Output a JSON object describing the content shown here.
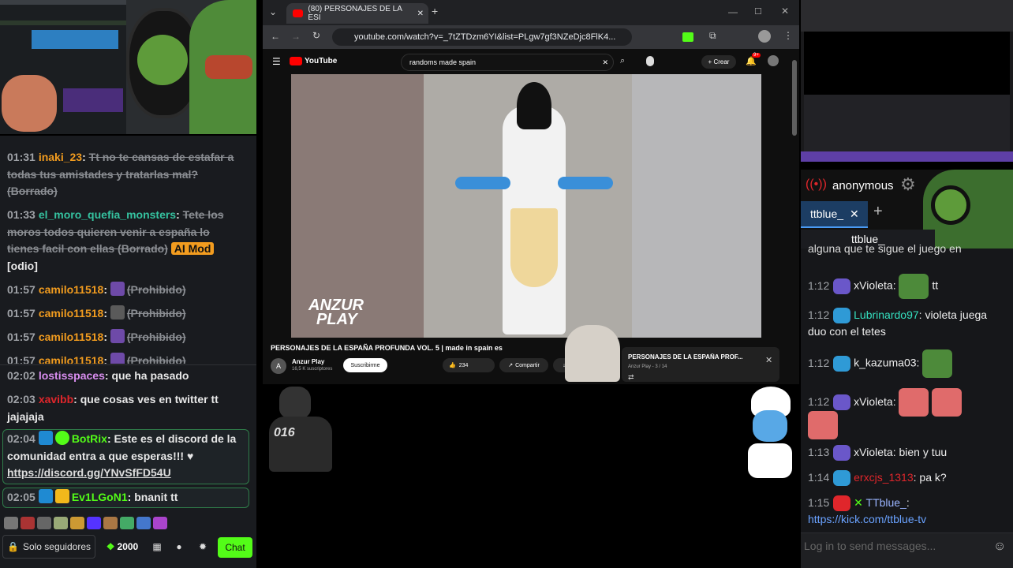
{
  "left_chat": {
    "messages": [
      {
        "time": "01:31",
        "user": "inaki_23",
        "user_color": "#f29c1f",
        "text": "Tt no te cansas de estafar a todas tus amistades y tratarlas mal? (Borrado)"
      },
      {
        "time": "01:33",
        "user": "el_moro_quefia_monsters",
        "user_color": "#35c3a0",
        "text": "Tete los moros todos quieren venir a españa lo tienes facil con ellas (Borrado)",
        "badge": "AI Mod",
        "extra": "[odio]"
      },
      {
        "time": "01:57",
        "user": "camilo11518",
        "user_color": "#f29c1f",
        "text": "(Prohibido)"
      },
      {
        "time": "01:57",
        "user": "camilo11518",
        "user_color": "#f29c1f",
        "text": "(Prohibido)"
      },
      {
        "time": "01:57",
        "user": "camilo11518",
        "user_color": "#f29c1f",
        "text": "(Prohibido)"
      },
      {
        "time": "01:57",
        "user": "camilo11518",
        "user_color": "#f29c1f",
        "text": "(Prohibido)"
      },
      {
        "time": "02:02",
        "user": "lostisspaces",
        "user_color": "#d98ef0",
        "text": "que ha pasado"
      },
      {
        "time": "02:03",
        "user": "xavibb",
        "user_color": "#e0262b",
        "text": "que cosas ves en twitter tt jajajaja"
      },
      {
        "time": "02:04",
        "user": "BotRix",
        "user_color": "#53fc18",
        "text": "Este es el discord de la comunidad entra a que esperas!!! ♥",
        "link": "https://discord.gg/YNvSfFD54U"
      },
      {
        "time": "02:05",
        "user": "Ev1LGoN1",
        "user_color": "#53fc18",
        "text": "bnanit tt"
      }
    ],
    "followers_only": "Solo seguidores",
    "points": "2000",
    "chat_button": "Chat"
  },
  "browser": {
    "tab_title": "(80) PERSONAJES DE LA ESI",
    "url": "youtube.com/watch?v=_7tZTDzm6YI&list=PLgw7gf3NZeDjc8FlK4...",
    "yt_logo": "YouTube",
    "search_value": "randoms made spain",
    "create_label": "Crear",
    "notif_count": "9+",
    "watermark_1": "ANZUR",
    "watermark_2": "PLAY",
    "video_title": "PERSONAJES DE LA ESPAÑA PROFUNDA VOL. 5 | made in spain es",
    "channel_name": "Anzur Play",
    "channel_subs": "16,5 K suscriptores",
    "subscribe_label": "Suscribirme",
    "likes": "234",
    "share_label": "Compartir",
    "download_label": "De",
    "mini_title": "PERSONAJES DE LA ESPAÑA PROF...",
    "mini_sub": "Anzur Play - 3 / 14"
  },
  "right_panel": {
    "username": "anonymous",
    "tab_label": "ttblue_",
    "channel_label": "ttblue_",
    "messages": [
      {
        "time": "",
        "user": "",
        "user_color": "#eee",
        "text": "alguna que te sigue el juego en",
        "partial": true
      },
      {
        "time": "1:12",
        "user": "xVioleta",
        "user_color": "#eee",
        "text": "tt",
        "emote": "pepe"
      },
      {
        "time": "1:12",
        "user": "Lubrinardo97",
        "user_color": "#35e0c0",
        "text": "violeta juega duo con el tetes"
      },
      {
        "time": "1:12",
        "user": "k_kazuma03",
        "user_color": "#eee",
        "text": "",
        "emote": "pepe"
      },
      {
        "time": "1:12",
        "user": "xVioleta",
        "user_color": "#eee",
        "text": "",
        "emote": "cats"
      },
      {
        "time": "1:13",
        "user": "xVioleta",
        "user_color": "#eee",
        "text": "bien y tuu"
      },
      {
        "time": "1:14",
        "user": "erxcjs_1313",
        "user_color": "#e0262b",
        "text": "pa k?"
      },
      {
        "time": "1:15",
        "user": "TTblue_",
        "user_color": "#9ab4ff",
        "text": "",
        "link": "https://kick.com/ttblue-tv"
      }
    ],
    "input_placeholder": "Log in to send messages..."
  },
  "colors": {
    "kick_green": "#53fc18",
    "youtube_red": "#ff0000",
    "chat_bg": "#191b1f"
  }
}
